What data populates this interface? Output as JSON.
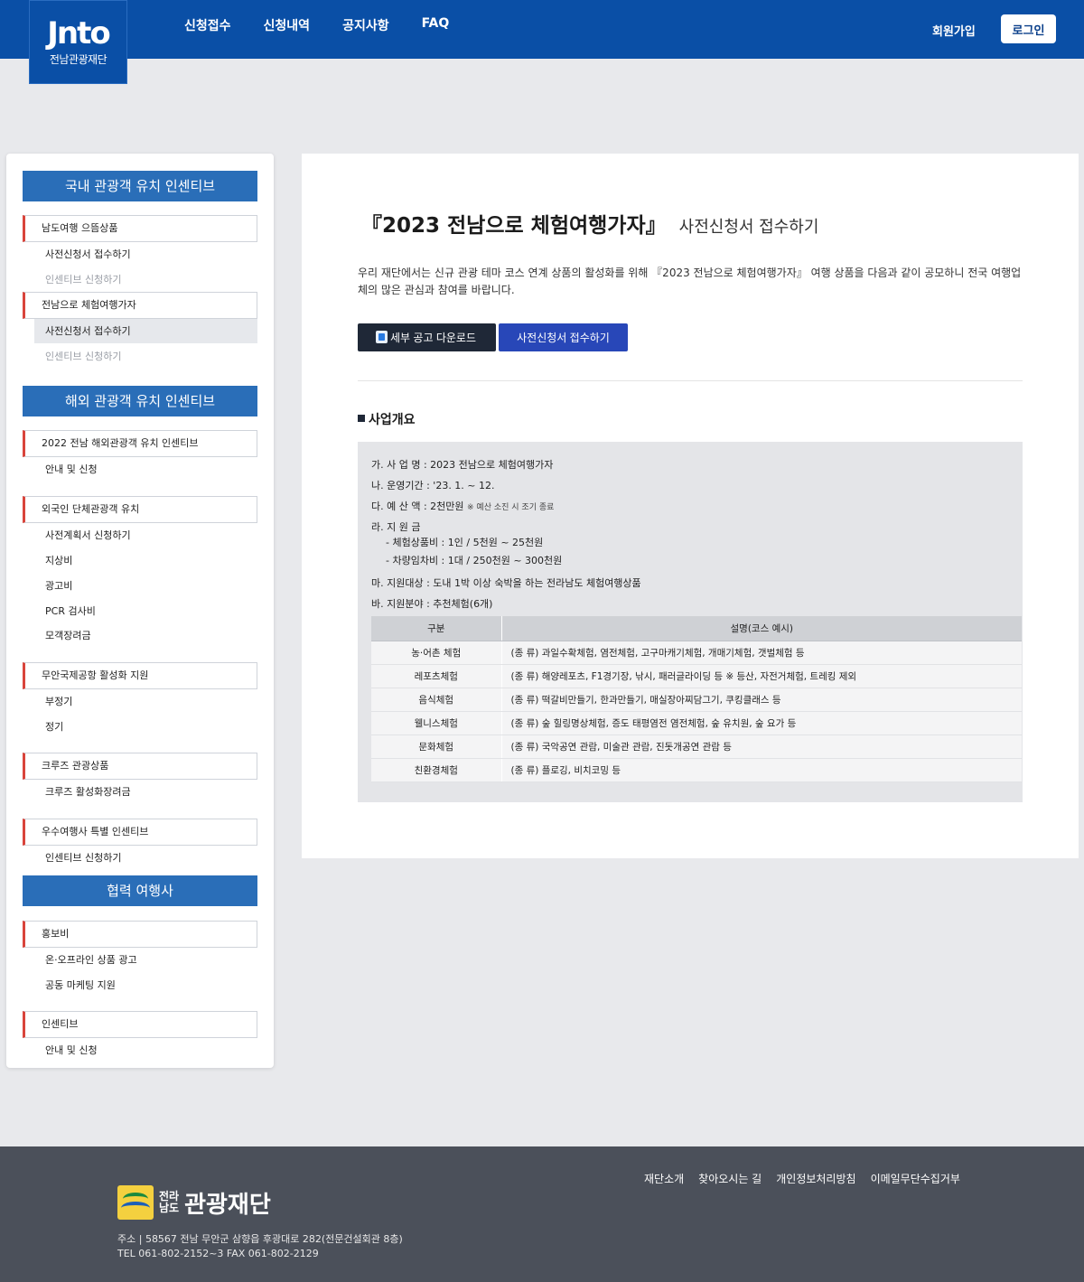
{
  "header": {
    "logo_mark": "Jnto",
    "logo_sub": "전남관광재단",
    "nav": [
      "신청접수",
      "신청내역",
      "공지사항",
      "FAQ"
    ],
    "join": "회원가입",
    "login": "로그인"
  },
  "sidebar": {
    "sections": [
      {
        "title": "국내 관광객 유치 인센티브"
      },
      {
        "title": "해외 관광객 유치 인센티브"
      },
      {
        "title": "협력 여행사"
      }
    ],
    "groups": [
      "남도여행 으뜸상품",
      "전남으로 체험여행가자",
      "2022 전남 해외관광객 유치 인센티브",
      "외국인 단체관광객 유치",
      "무안국제공항 활성화 지원",
      "크루즈 관광상품",
      "우수여행사 특별 인센티브",
      "홍보비",
      "인센티브"
    ],
    "items": [
      "사전신청서 접수하기",
      "인센티브 신청하기",
      "사전신청서 접수하기",
      "인센티브 신청하기",
      "안내 및 신청",
      "사전계획서 신청하기",
      "지상비",
      "광고비",
      "PCR 검사비",
      "모객장려금",
      "부정기",
      "정기",
      "크루즈 활성화장려금",
      "인센티브 신청하기",
      "온·오프라인 상품 광고",
      "공동 마케팅 지원",
      "안내 및 신청"
    ]
  },
  "main": {
    "title": "『2023 전남으로 체험여행가자』",
    "title_sub": "사전신청서 접수하기",
    "intro": "우리 재단에서는 신규 관광 테마 코스 연계 상품의 활성화를 위해 『2023 전남으로 체험여행가자』 여행 상품을 다음과 같이 공모하니 전국 여행업체의 많은 관심과 참여를 바랍니다.",
    "download_btn": "세부 공고 다운로드",
    "apply_btn": "사전신청서 접수하기",
    "section_heading": "사업개요",
    "overview": {
      "l1": "가. 사 업 명 : 2023 전남으로 체험여행가자",
      "l2": "나. 운영기간 : '23. 1. ~ 12.",
      "l3": "다. 예 산 액 : 2천만원",
      "l3_note": "※ 예산 소진 시 조기 종료",
      "l4": "라. 지 원 금",
      "l4a": "- 체험상품비 : 1인 / 5천원 ~ 25천원",
      "l4b": "- 차량임차비 : 1대 / 250천원 ~ 300천원",
      "l5": "마. 지원대상 : 도내 1박 이상 숙박을 하는 전라남도 체험여행상품",
      "l6": "바. 지원분야 : 추천체험(6개)"
    },
    "table": {
      "headers": [
        "구분",
        "설명(코스 예시)"
      ],
      "rows": [
        [
          "농·어촌 체험",
          "(종 류) 과일수확체험, 염전체험, 고구마캐기체험, 개매기체험, 갯벌체험 등"
        ],
        [
          "레포츠체험",
          "(종 류) 해양레포츠, F1경기장, 낚시, 패러글라이딩 등 ※ 등산, 자전거체험, 트레킹 제외"
        ],
        [
          "음식체험",
          "(종 류) 떡갈비만들기, 한과만들기, 매실장아찌담그기, 쿠킹클래스 등"
        ],
        [
          "웰니스체험",
          "(종 류) 숲 힐링명상체험, 증도 태평염전 염전체험, 숲 유치원, 숲 요가 등"
        ],
        [
          "문화체험",
          "(종 류) 국악공연 관람, 미술관 관람, 진돗개공연 관람 등"
        ],
        [
          "친환경체험",
          "(종 류) 플로깅, 비치코밍 등"
        ]
      ]
    }
  },
  "footer": {
    "links": [
      "재단소개",
      "찾아오시는 길",
      "개인정보처리방침",
      "이메일무단수집거부"
    ],
    "logo_small_1": "전라",
    "logo_small_2": "남도",
    "logo_big": "관광재단",
    "address": "주소 | 58567 전남 무안군 삼향읍 후광대로 282(전문건설회관 8층)",
    "tel": "TEL 061-802-2152~3 FAX 061-802-2129"
  }
}
